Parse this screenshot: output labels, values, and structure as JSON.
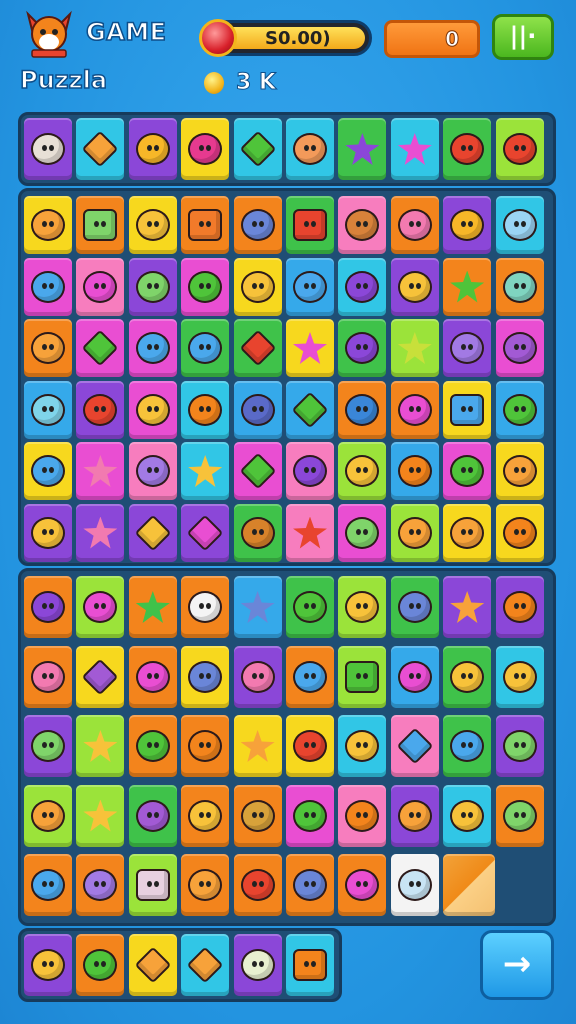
{
  "header": {
    "title_top": "GAME",
    "title_bottom": "Puzzla",
    "balance": "S0.00)",
    "score": "0",
    "menu_label": "||·",
    "coins": "3 K"
  },
  "palette": {
    "yellow": "#f7d81e",
    "orange": "#f3841c",
    "green": "#3fc24a",
    "lime": "#9be33a",
    "blue": "#35a9ea",
    "cyan": "#31c6e6",
    "purple": "#8b47d8",
    "magenta": "#e94ed2",
    "pink": "#f77dbe",
    "red": "#ec4a3a"
  },
  "boards": [
    {
      "name": "top-strip",
      "rows": [
        [
          [
            "purple",
            "#e8e0d6",
            "round"
          ],
          [
            "cyan",
            "#f7a23a",
            "dia"
          ],
          [
            "purple",
            "#f7b728",
            "round"
          ],
          [
            "yellow",
            "#e63a8f",
            "round"
          ],
          [
            "cyan",
            "#4fc43a",
            "dia"
          ],
          [
            "cyan",
            "#f39a5a",
            "round"
          ],
          [
            "green",
            "#8b47d8",
            "star"
          ],
          [
            "cyan",
            "#e94ed2",
            "star"
          ],
          [
            "green",
            "#e8442e",
            "round"
          ],
          [
            "lime",
            "#e8442e",
            "round"
          ]
        ]
      ]
    },
    {
      "name": "main-board",
      "rows": [
        [
          [
            "yellow",
            "#f7a23a",
            "round"
          ],
          [
            "orange",
            "#7fd46a",
            "sq"
          ],
          [
            "yellow",
            "#f7c23a",
            "round"
          ],
          [
            "orange",
            "#f27a2a",
            "sq"
          ],
          [
            "orange",
            "#6a86d8",
            "round"
          ],
          [
            "green",
            "#e8442e",
            "sq"
          ],
          [
            "pink",
            "#d8823a",
            "round"
          ],
          [
            "orange",
            "#f27ab0",
            "round"
          ],
          [
            "purple",
            "#f7b728",
            "round"
          ],
          [
            "cyan",
            "#9ad4f4",
            "round"
          ]
        ],
        [
          [
            "magenta",
            "#4aa8ec",
            "round"
          ],
          [
            "pink",
            "#e94ed2",
            "round"
          ],
          [
            "purple",
            "#7fd46a",
            "round"
          ],
          [
            "magenta",
            "#4fc43a",
            "round"
          ],
          [
            "yellow",
            "#f7c23a",
            "round"
          ],
          [
            "blue",
            "#4aa8ec",
            "round"
          ],
          [
            "cyan",
            "#8b47d8",
            "round"
          ],
          [
            "purple",
            "#f7c23a",
            "round"
          ],
          [
            "orange",
            "#4fc43a",
            "star"
          ],
          [
            "orange",
            "#7fd4c0",
            "round"
          ]
        ],
        [
          [
            "orange",
            "#f7a23a",
            "round"
          ],
          [
            "magenta",
            "#4fc43a",
            "dia"
          ],
          [
            "magenta",
            "#4aa8ec",
            "round"
          ],
          [
            "green",
            "#4aa8ec",
            "round"
          ],
          [
            "green",
            "#e8442e",
            "dia"
          ],
          [
            "yellow",
            "#e94ed2",
            "star"
          ],
          [
            "green",
            "#8b47d8",
            "round"
          ],
          [
            "lime",
            "#c8e03a",
            "star"
          ],
          [
            "purple",
            "#a27ae4",
            "round"
          ],
          [
            "magenta",
            "#a25ad4",
            "round"
          ]
        ],
        [
          [
            "blue",
            "#7fd4ea",
            "round"
          ],
          [
            "purple",
            "#e8442e",
            "round"
          ],
          [
            "magenta",
            "#f7c23a",
            "round"
          ],
          [
            "cyan",
            "#f3841c",
            "round"
          ],
          [
            "blue",
            "#5a6ac8",
            "round"
          ],
          [
            "blue",
            "#4fc43a",
            "dia"
          ],
          [
            "orange",
            "#3a86d8",
            "round"
          ],
          [
            "orange",
            "#e94ed2",
            "round"
          ],
          [
            "yellow",
            "#4aa8ec",
            "sq"
          ],
          [
            "blue",
            "#4fc43a",
            "round"
          ]
        ],
        [
          [
            "yellow",
            "#4aa8ec",
            "round"
          ],
          [
            "magenta",
            "#f27ab0",
            "star"
          ],
          [
            "pink",
            "#a27ae4",
            "round"
          ],
          [
            "cyan",
            "#f7c23a",
            "star"
          ],
          [
            "magenta",
            "#4fc43a",
            "dia"
          ],
          [
            "pink",
            "#8b47d8",
            "round"
          ],
          [
            "lime",
            "#f7c23a",
            "round"
          ],
          [
            "blue",
            "#f3841c",
            "round"
          ],
          [
            "magenta",
            "#4fc43a",
            "round"
          ],
          [
            "yellow",
            "#f7a23a",
            "round"
          ]
        ],
        [
          [
            "purple",
            "#f7c23a",
            "round"
          ],
          [
            "purple",
            "#f27ab0",
            "star"
          ],
          [
            "purple",
            "#f7c23a",
            "dia"
          ],
          [
            "purple",
            "#e94ed2",
            "dia"
          ],
          [
            "green",
            "#d8822a",
            "round"
          ],
          [
            "pink",
            "#e8442e",
            "star"
          ],
          [
            "magenta",
            "#7fd46a",
            "round"
          ],
          [
            "lime",
            "#f7a23a",
            "round"
          ],
          [
            "yellow",
            "#f7a23a",
            "round"
          ],
          [
            "yellow",
            "#f3841c",
            "round"
          ]
        ]
      ]
    },
    {
      "name": "lower-board",
      "rows": [
        [
          [
            "orange",
            "#8b47d8",
            "round"
          ],
          [
            "lime",
            "#e94ed2",
            "round"
          ],
          [
            "orange",
            "#3fc24a",
            "star"
          ],
          [
            "orange",
            "#f4f4f4",
            "round"
          ],
          [
            "blue",
            "#6a86d8",
            "star"
          ],
          [
            "green",
            "#4fc43a",
            "round"
          ],
          [
            "lime",
            "#f7c23a",
            "round"
          ],
          [
            "green",
            "#6a86d8",
            "round"
          ],
          [
            "purple",
            "#f7a23a",
            "star"
          ],
          [
            "purple",
            "#f3841c",
            "round"
          ]
        ],
        [
          [
            "orange",
            "#f27ab0",
            "round"
          ],
          [
            "yellow",
            "#a25ad4",
            "dia"
          ],
          [
            "orange",
            "#e94ed2",
            "round"
          ],
          [
            "yellow",
            "#6a86d8",
            "round"
          ],
          [
            "purple",
            "#f27ab0",
            "round"
          ],
          [
            "orange",
            "#4aa8ec",
            "round"
          ],
          [
            "lime",
            "#4fc43a",
            "sq"
          ],
          [
            "blue",
            "#e94ed2",
            "round"
          ],
          [
            "green",
            "#f7c23a",
            "round"
          ],
          [
            "cyan",
            "#f7c23a",
            "round"
          ]
        ],
        [
          [
            "purple",
            "#7fd46a",
            "round"
          ],
          [
            "lime",
            "#f7c23a",
            "star"
          ],
          [
            "orange",
            "#4fc43a",
            "round"
          ],
          [
            "orange",
            "#f3841c",
            "round"
          ],
          [
            "yellow",
            "#f7a23a",
            "star"
          ],
          [
            "yellow",
            "#e8442e",
            "round"
          ],
          [
            "cyan",
            "#f7c23a",
            "round"
          ],
          [
            "pink",
            "#4aa8ec",
            "dia"
          ],
          [
            "green",
            "#4aa8ec",
            "round"
          ],
          [
            "purple",
            "#7fd46a",
            "round"
          ]
        ],
        [
          [
            "lime",
            "#f7a23a",
            "round"
          ],
          [
            "lime",
            "#f7c23a",
            "star"
          ],
          [
            "green",
            "#a25ad4",
            "round"
          ],
          [
            "orange",
            "#f7c23a",
            "round"
          ],
          [
            "orange",
            "#d8a23a",
            "round"
          ],
          [
            "magenta",
            "#4fc43a",
            "round"
          ],
          [
            "pink",
            "#f3841c",
            "round"
          ],
          [
            "purple",
            "#f7a23a",
            "round"
          ],
          [
            "cyan",
            "#f7c23a",
            "round"
          ],
          [
            "orange",
            "#7fd46a",
            "round"
          ]
        ],
        [
          [
            "orange",
            "#4aa8ec",
            "round"
          ],
          [
            "orange",
            "#a27ae4",
            "round"
          ],
          [
            "lime",
            "#e8d0e0",
            "sq"
          ],
          [
            "orange",
            "#f7a23a",
            "round"
          ],
          [
            "orange",
            "#e8442e",
            "round"
          ],
          [
            "orange",
            "#6a86d8",
            "round"
          ],
          [
            "orange",
            "#e94ed2",
            "round"
          ],
          [
            "white",
            "#c8e4f4",
            "round"
          ],
          [
            "fold",
            "",
            ""
          ]
        ]
      ]
    },
    {
      "name": "tray",
      "rows": [
        [
          [
            "purple",
            "#f7c23a",
            "round"
          ],
          [
            "orange",
            "#4fc43a",
            "round"
          ],
          [
            "yellow",
            "#f7a23a",
            "dia"
          ],
          [
            "cyan",
            "#f7a23a",
            "dia"
          ],
          [
            "purple",
            "#e8f0d0",
            "round"
          ],
          [
            "cyan",
            "#f3841c",
            "sq"
          ]
        ]
      ]
    }
  ],
  "next_button": "→"
}
